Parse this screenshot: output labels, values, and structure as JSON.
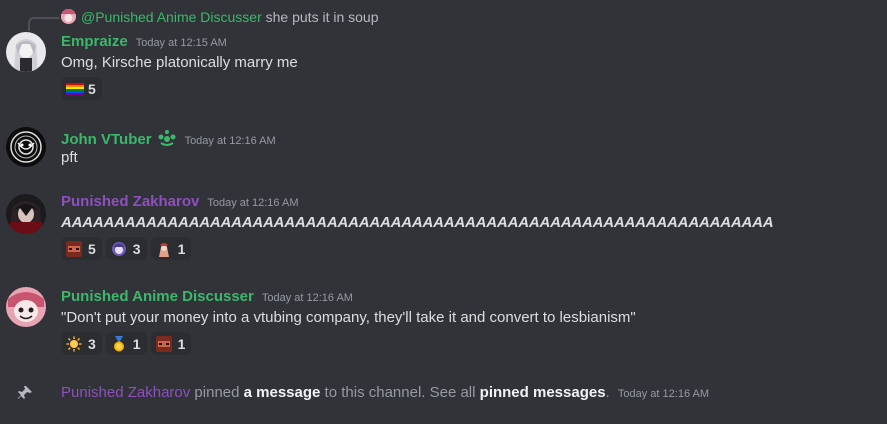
{
  "reply": {
    "author": "@Punished Anime Discusser",
    "content": "she puts it in soup"
  },
  "messages": [
    {
      "author": "Empraize",
      "author_color": "#3bb86b",
      "timestamp": "Today at 12:15 AM",
      "content": "Omg, Kirsche platonically marry me",
      "reactions": [
        {
          "emoji": "rainbow-flag",
          "count": "5"
        }
      ]
    },
    {
      "author": "John VTuber",
      "author_color": "#3bb86b",
      "timestamp": "Today at 12:16 AM",
      "content": "pft",
      "reactions": []
    },
    {
      "author": "Punished Zakharov",
      "author_color": "#8e4fbf",
      "timestamp": "Today at 12:16 AM",
      "content": "AAAAAAAAAAAAAAAAAAAAAAAAAAAAAAAAAAAAAAAAAAAAAAAAAAAAAAAAAAAAAAAAAAA",
      "reactions": [
        {
          "emoji": "custom-emoji-red",
          "count": "5"
        },
        {
          "emoji": "custom-emoji-purple",
          "count": "3"
        },
        {
          "emoji": "custom-emoji-pink",
          "count": "1"
        }
      ]
    },
    {
      "author": "Punished Anime Discusser",
      "author_color": "#3bb86b",
      "timestamp": "Today at 12:16 AM",
      "content": "\"Don't put your money into a vtubing company, they'll take it and convert to lesbianism\"",
      "reactions": [
        {
          "emoji": "sun-emoji",
          "count": "3"
        },
        {
          "emoji": "medal-emoji",
          "count": "1"
        },
        {
          "emoji": "custom-emoji-red",
          "count": "1"
        }
      ]
    }
  ],
  "pin": {
    "author": "Punished Zakharov",
    "text1": "pinned",
    "link1": "a message",
    "text2": "to this channel. See all",
    "link2": "pinned messages",
    "text3": ".",
    "timestamp": "Today at 12:16 AM"
  }
}
